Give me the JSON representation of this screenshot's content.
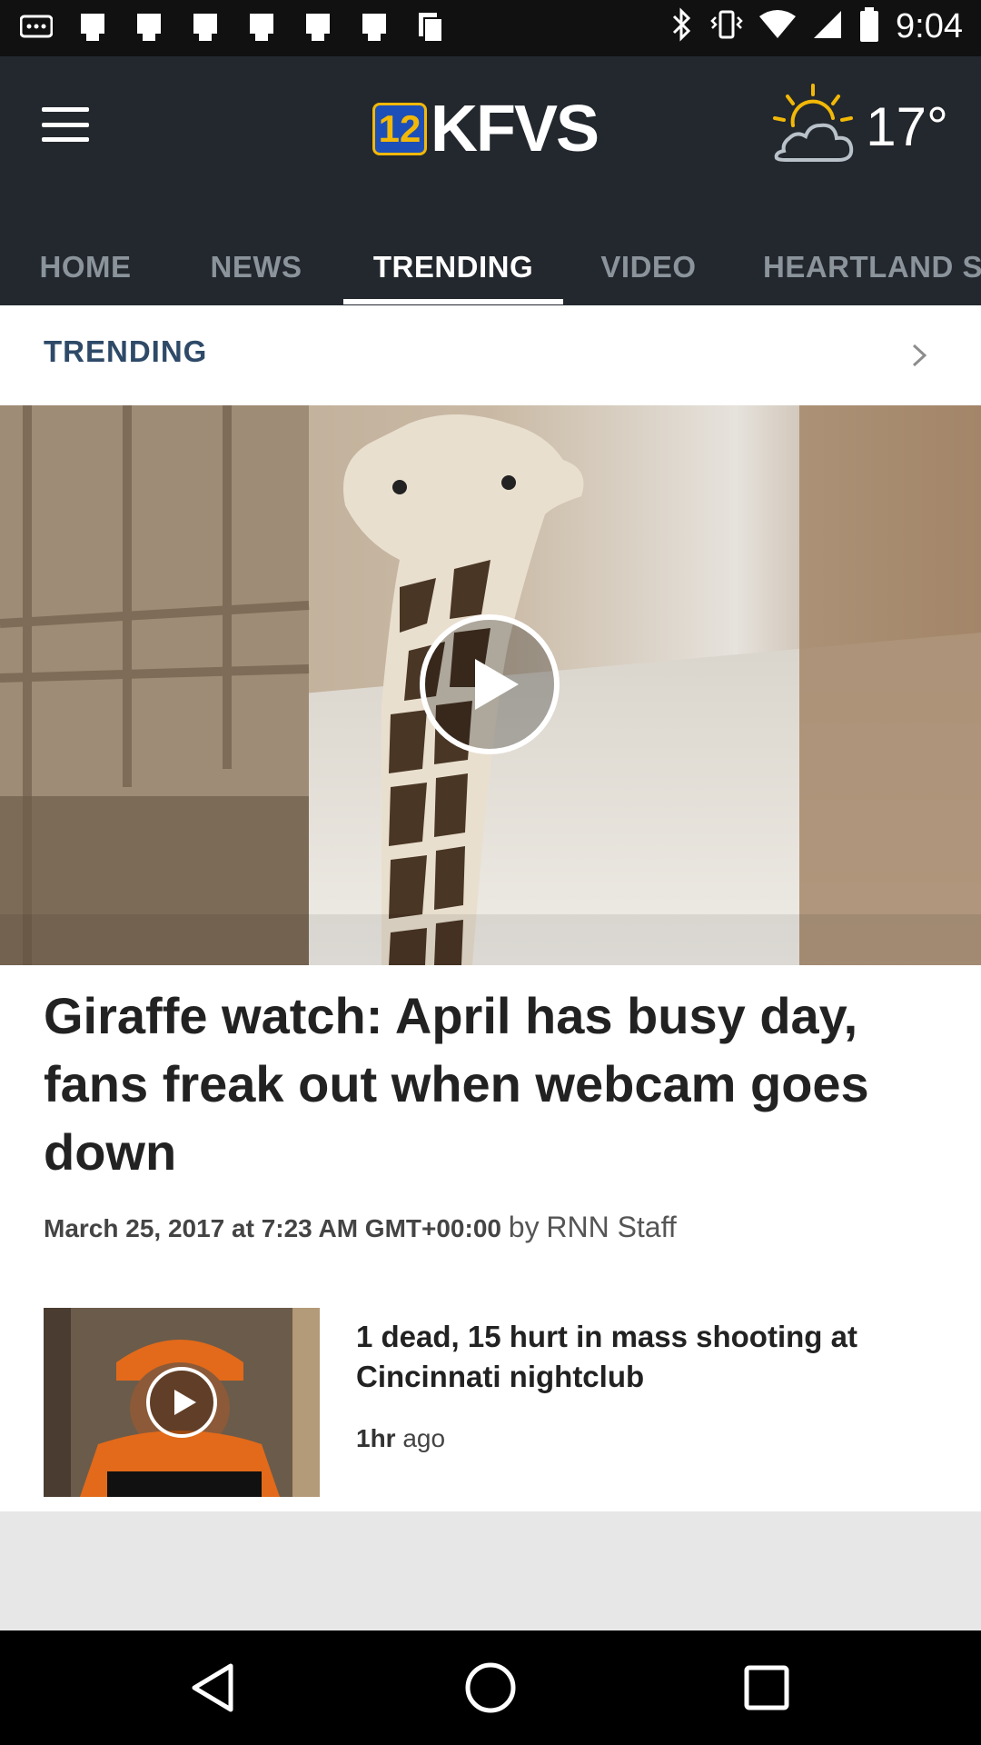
{
  "status_bar": {
    "time": "9:04"
  },
  "header": {
    "logo_number": "12",
    "logo_text": "KFVS",
    "weather_icon": "partly-cloudy-icon",
    "temperature": "17°"
  },
  "tabs": [
    {
      "label": "HOME",
      "active": false
    },
    {
      "label": "NEWS",
      "active": false
    },
    {
      "label": "TRENDING",
      "active": true
    },
    {
      "label": "VIDEO",
      "active": false
    },
    {
      "label": "HEARTLAND S",
      "active": false
    }
  ],
  "section": {
    "title": "TRENDING"
  },
  "featured": {
    "headline": "Giraffe watch: April has busy day, fans freak out when webcam goes down",
    "date": "March 25, 2017 at 7:23 AM GMT+00:00",
    "by_prefix": "by",
    "author": "RNN Staff"
  },
  "stories": [
    {
      "title": "1 dead, 15 hurt in mass shooting at Cincinnati nightclub",
      "time_value": "1hr",
      "time_suffix": "ago"
    }
  ],
  "colors": {
    "header_bg": "#23282e",
    "section_title": "#2e4a68",
    "logo_blue": "#1d4fb8",
    "logo_yellow": "#f2b807"
  }
}
